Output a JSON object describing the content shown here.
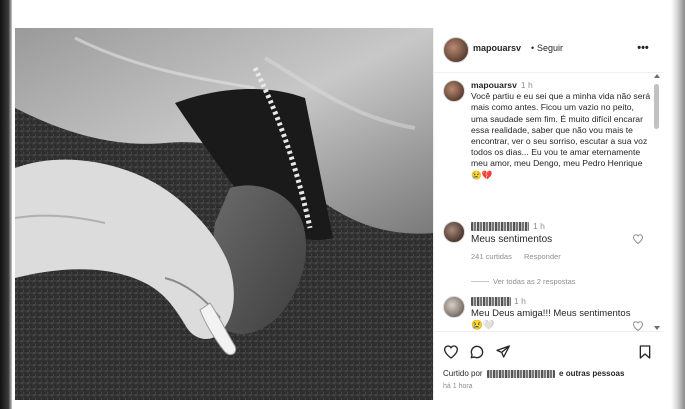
{
  "post": {
    "image_alt": "black and white photo of a hand holding another hand",
    "username": "mapouarsv",
    "dot": "•",
    "follow_label": "Seguir",
    "more_label": "•••"
  },
  "caption": {
    "username": "mapouarsv",
    "time": "1 h",
    "text": "Você partiu e eu sei que a minha vida não será mais como antes. Ficou um vazio no peito, uma saudade sem fim. É muito difícil encarar essa realidade, saber que não vou mais te encontrar, ver o seu sorriso, escutar a sua voz todos os dias... Eu vou te amar eternamente meu amor, meu Dengo, meu Pedro Henrique 😢💔"
  },
  "comments": [
    {
      "time": "1 h",
      "text": "Meus sentimentos",
      "likes": "241 curtidas",
      "reply_label": "Responder",
      "view_replies": "Ver todas as 2 respostas"
    },
    {
      "time": "1 h",
      "text": "Meu Deus amiga!!! Meus sentimentos 😢🤍"
    }
  ],
  "actions": {
    "liked_by_prefix": "Curtido por",
    "liked_by_suffix": "e outras pessoas",
    "post_time": "há 1 hora"
  },
  "colors": {
    "text": "#262626",
    "secondary": "#8e8e8e",
    "divider": "#efefef"
  }
}
